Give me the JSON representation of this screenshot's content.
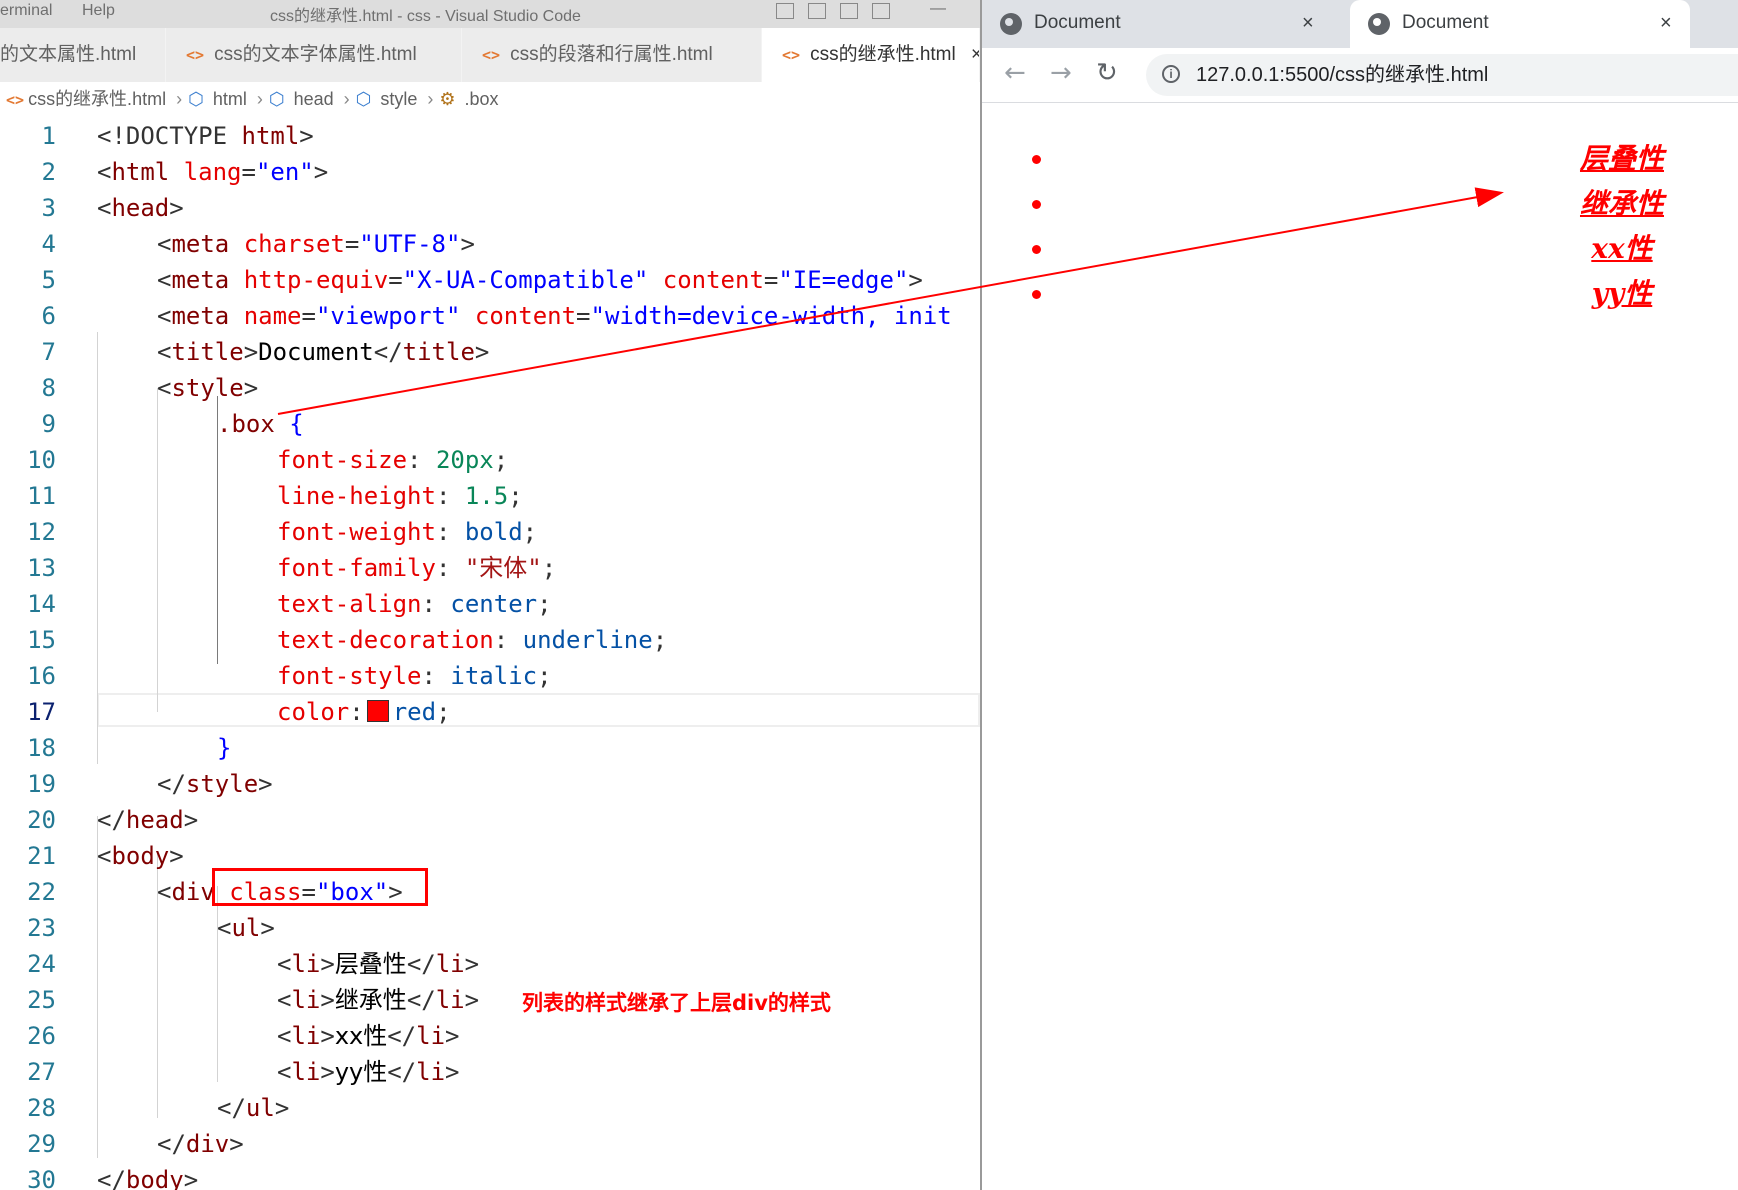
{
  "vscode": {
    "menu": [
      "erminal",
      "Help"
    ],
    "window_title": "css的继承性.html - css - Visual Studio Code",
    "tabs": [
      {
        "label": "的文本属性.html",
        "active": false
      },
      {
        "label": "css的文本字体属性.html",
        "active": false
      },
      {
        "label": "css的段落和行属性.html",
        "active": false
      },
      {
        "label": "css的继承性.html",
        "active": true
      }
    ],
    "tab_close": "×",
    "file_icon": "<>",
    "breadcrumb": [
      "css的继承性.html",
      "html",
      "head",
      "style",
      ".box"
    ],
    "line_numbers": [
      "1",
      "2",
      "3",
      "4",
      "5",
      "6",
      "7",
      "8",
      "9",
      "10",
      "11",
      "12",
      "13",
      "14",
      "15",
      "16",
      "17",
      "18",
      "19",
      "20",
      "21",
      "22",
      "23",
      "24",
      "25",
      "26",
      "27",
      "28",
      "29",
      "30"
    ],
    "current_line": "17",
    "code": {
      "l1": {
        "a": "<!DOCTYPE ",
        "b": "html",
        "c": ">"
      },
      "l2": {
        "a": "<",
        "b": "html",
        "c": " lang",
        "d": "=",
        "e": "\"en\"",
        "f": ">"
      },
      "l3": {
        "a": "<",
        "b": "head",
        "c": ">"
      },
      "l4": {
        "a": "<",
        "b": "meta",
        "c": " charset",
        "d": "=",
        "e": "\"UTF-8\"",
        "f": ">"
      },
      "l5": {
        "a": "<",
        "b": "meta",
        "c": " http-equiv",
        "d": "=",
        "e": "\"X-UA-Compatible\"",
        "g": " content",
        "h": "=",
        "i": "\"IE=edge\"",
        "f": ">"
      },
      "l6": {
        "a": "<",
        "b": "meta",
        "c": " name",
        "d": "=",
        "e": "\"viewport\"",
        "g": " content",
        "h": "=",
        "i": "\"width=device-width, init"
      },
      "l7": {
        "a": "<",
        "b": "title",
        "c": ">",
        "d": "Document",
        "e": "</",
        "f": "title",
        "g": ">"
      },
      "l8": {
        "a": "<",
        "b": "style",
        "c": ">"
      },
      "l9": {
        "a": ".box",
        "b": " {"
      },
      "l10": {
        "p": "font-size",
        "c": ": ",
        "v": "20px",
        "s": ";"
      },
      "l11": {
        "p": "line-height",
        "c": ": ",
        "v": "1.5",
        "s": ";"
      },
      "l12": {
        "p": "font-weight",
        "c": ": ",
        "v": "bold",
        "s": ";"
      },
      "l13": {
        "p": "font-family",
        "c": ": ",
        "v": "\"宋体\"",
        "s": ";"
      },
      "l14": {
        "p": "text-align",
        "c": ": ",
        "v": "center",
        "s": ";"
      },
      "l15": {
        "p": "text-decoration",
        "c": ": ",
        "v": "underline",
        "s": ";"
      },
      "l16": {
        "p": "font-style",
        "c": ": ",
        "v": "italic",
        "s": ";"
      },
      "l17": {
        "p": "color",
        "c": ":",
        "v": "red",
        "s": ";"
      },
      "l18": {
        "a": "}"
      },
      "l19": {
        "a": "</",
        "b": "style",
        "c": ">"
      },
      "l20": {
        "a": "</",
        "b": "head",
        "c": ">"
      },
      "l21": {
        "a": "<",
        "b": "body",
        "c": ">"
      },
      "l22": {
        "a": "<",
        "b": "div",
        "c": " class",
        "d": "=",
        "e": "\"box\"",
        "f": ">"
      },
      "l23": {
        "a": "<",
        "b": "ul",
        "c": ">"
      },
      "l24": {
        "a": "<",
        "b": "li",
        "c": ">",
        "d": "层叠性",
        "e": "</",
        "f": "li",
        "g": ">"
      },
      "l25": {
        "a": "<",
        "b": "li",
        "c": ">",
        "d": "继承性",
        "e": "</",
        "f": "li",
        "g": ">"
      },
      "l26": {
        "a": "<",
        "b": "li",
        "c": ">",
        "d": "xx性",
        "e": "</",
        "f": "li",
        "g": ">"
      },
      "l27": {
        "a": "<",
        "b": "li",
        "c": ">",
        "d": "yy性",
        "e": "</",
        "f": "li",
        "g": ">"
      },
      "l28": {
        "a": "</",
        "b": "ul",
        "c": ">"
      },
      "l29": {
        "a": "</",
        "b": "div",
        "c": ">"
      },
      "l30": {
        "a": "</",
        "b": "body",
        "c": ">"
      }
    },
    "annotation": "列表的样式继承了上层div的样式"
  },
  "browser": {
    "tabs": [
      {
        "title": "Document",
        "active": false
      },
      {
        "title": "Document",
        "active": true
      }
    ],
    "tab_close": "×",
    "nav": {
      "back": "←",
      "forward": "→",
      "reload": "↻"
    },
    "info_icon": "i",
    "url": "127.0.0.1:5500/css的继承性.html",
    "list_items": [
      "层叠性",
      "继承性",
      "xx性",
      "yy性"
    ]
  },
  "colors": {
    "annotation": "#ff0000",
    "list_text": "#ff0000",
    "tag": "#800000",
    "attribute": "#e50000",
    "string": "#0000ff"
  }
}
